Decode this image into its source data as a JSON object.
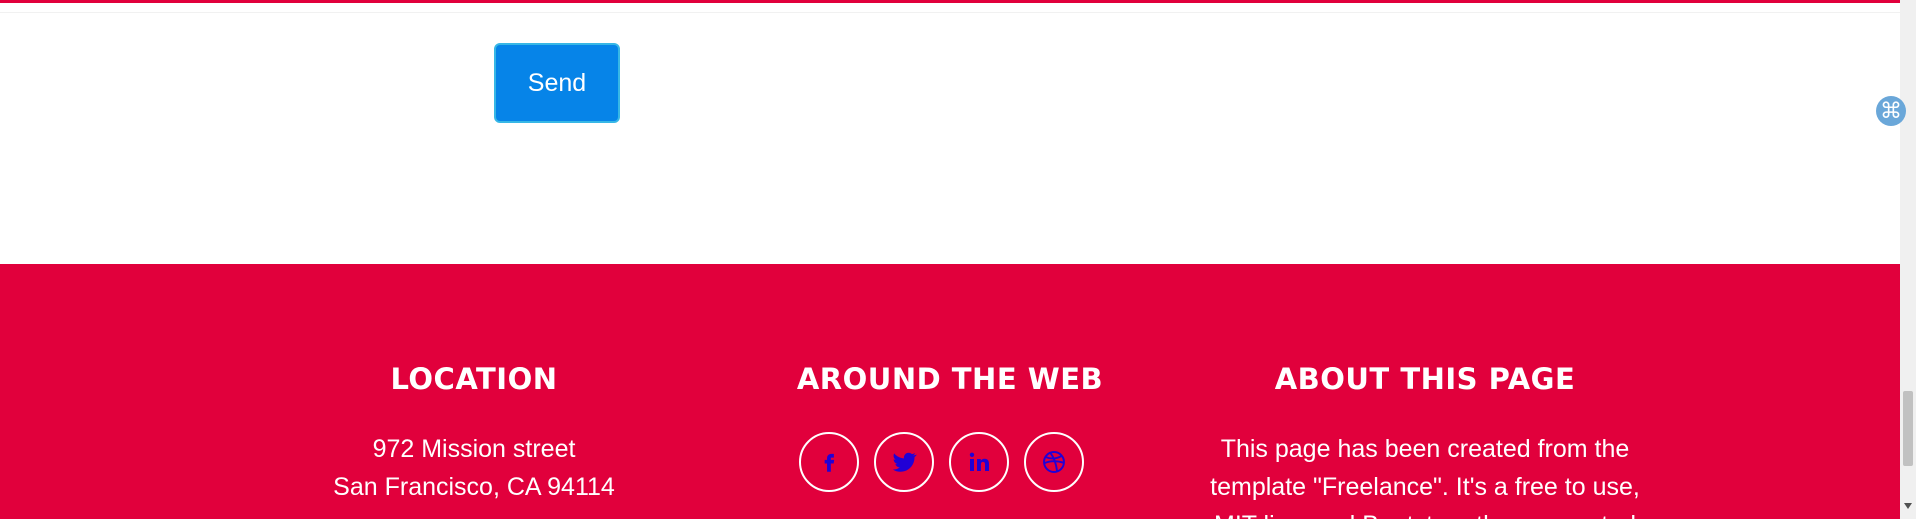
{
  "form": {
    "send_label": "Send"
  },
  "widget": {
    "icon": "⌘",
    "icon_name": "command-icon"
  },
  "footer": {
    "background_color": "#e1003c",
    "location": {
      "title": "LOCATION",
      "line1": "972 Mission street",
      "line2": "San Francisco, CA 94114"
    },
    "web": {
      "title": "AROUND THE WEB",
      "icons": [
        "facebook-icon",
        "twitter-icon",
        "linkedin-icon",
        "dribbble-icon"
      ],
      "icon_color": "#2100d6"
    },
    "about": {
      "title": "ABOUT THIS PAGE",
      "line1": "This page has been created from the",
      "line2": "template \"Freelance\". It's a free to use,",
      "line3": "MIT licensed Bootstrap theme created"
    }
  }
}
